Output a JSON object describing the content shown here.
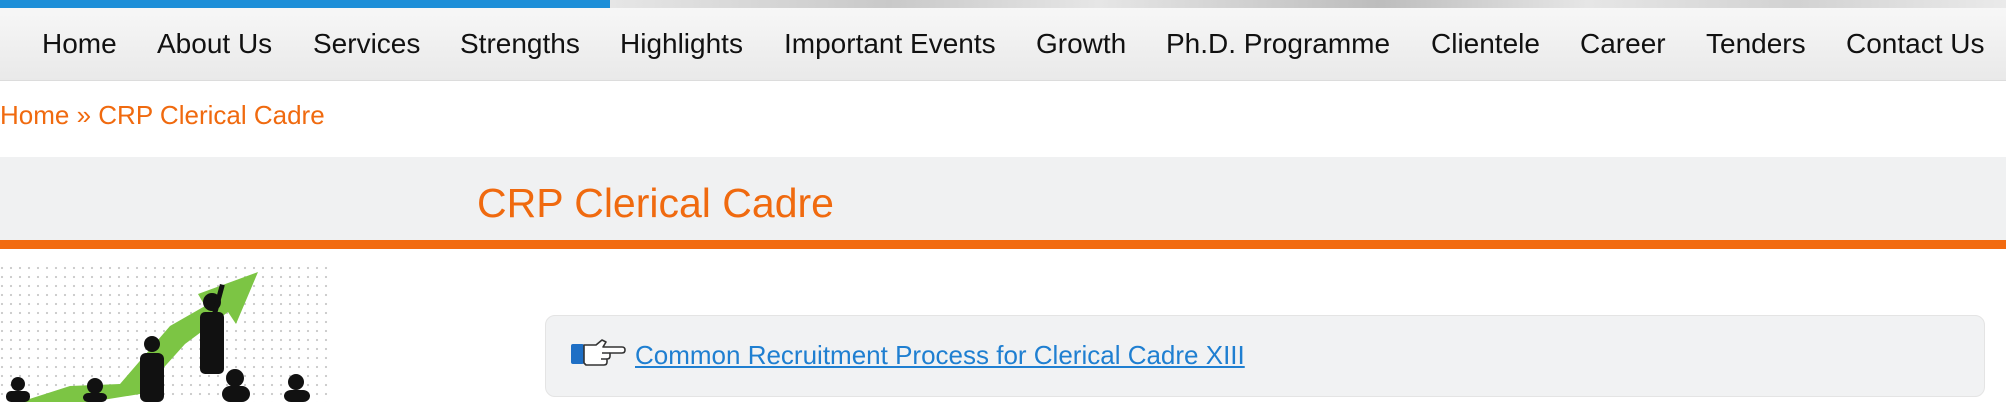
{
  "nav": {
    "items": [
      "Home",
      "About Us",
      "Services",
      "Strengths",
      "Highlights",
      "Important Events",
      "Growth",
      "Ph.D. Programme",
      "Clientele",
      "Career",
      "Tenders",
      "Contact Us"
    ]
  },
  "breadcrumb": {
    "home": "Home",
    "separator": " » ",
    "current": "CRP Clerical Cadre"
  },
  "page": {
    "title": "CRP Clerical Cadre"
  },
  "content": {
    "link_text": "Common Recruitment Process for Clerical Cadre XIII",
    "pointer_icon": "pointing-hand-icon"
  },
  "colors": {
    "accent": "#f26b10",
    "link": "#1f7fd1",
    "banner_blue": "#1e8fd8"
  }
}
